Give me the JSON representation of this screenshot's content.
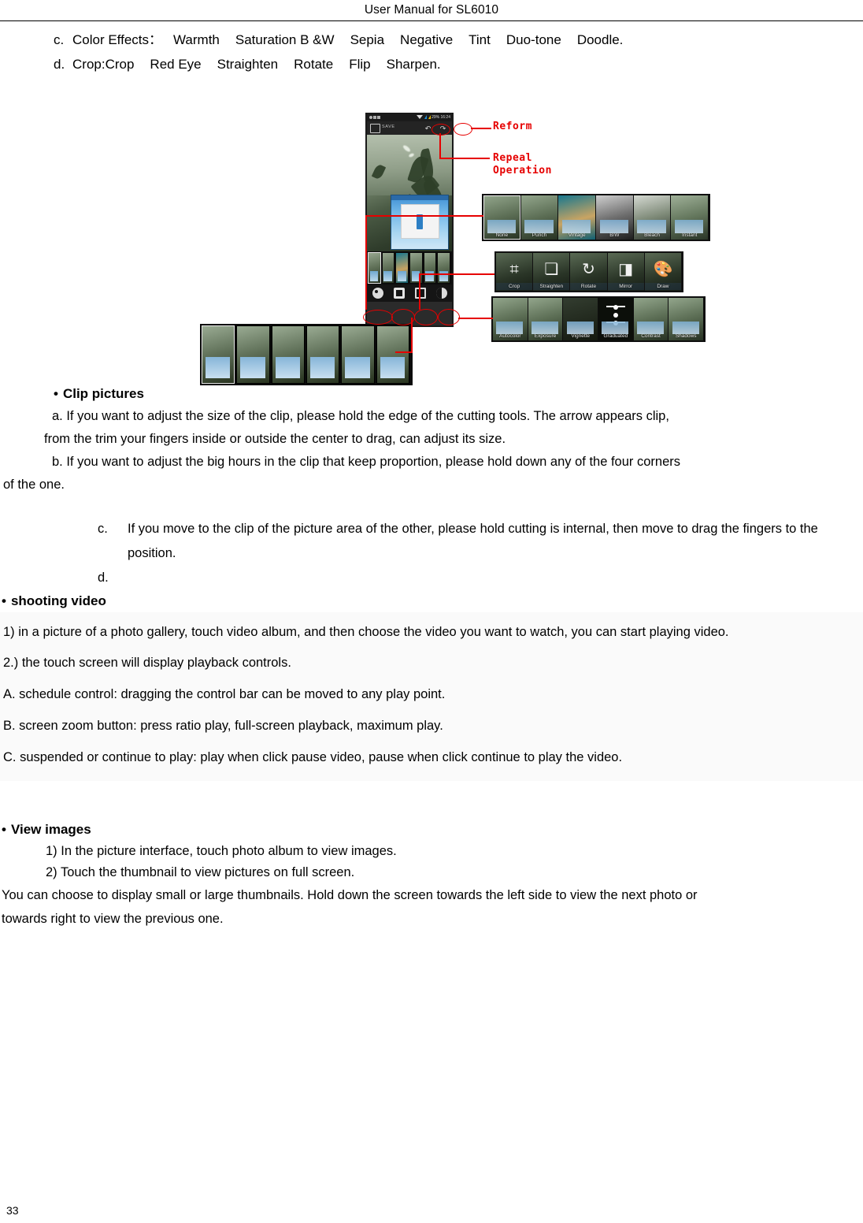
{
  "header": {
    "title": "User Manual for SL6010"
  },
  "top_list": {
    "c": {
      "label": "c.",
      "text": "Color Effects：",
      "items": [
        "Warmth",
        "Saturation B &W",
        "Sepia",
        "Negative",
        "Tint",
        "Duo-tone",
        "Doodle."
      ]
    },
    "d": {
      "label": "d.",
      "text": "Crop:Crop",
      "items": [
        "Red Eye",
        "Straighten",
        "Rotate",
        "Flip",
        "Sharpen."
      ]
    }
  },
  "figure": {
    "name": "photo-editor-screenshot",
    "annotations": [
      {
        "text": "Reform"
      },
      {
        "text": "Repeal\nOperation"
      }
    ],
    "phone": {
      "status_bar": {
        "battery": "29%",
        "time": "16:24"
      },
      "app_bar": {
        "save_label": "SAVE",
        "undo_icon": "undo-icon",
        "redo_icon": "redo-icon"
      },
      "toolbar_icons": [
        "filters-icon",
        "frames-icon",
        "crop-icon",
        "adjust-icon"
      ]
    },
    "filter_panel": {
      "labels": [
        "None",
        "Punch",
        "Vintage",
        "B/W",
        "Bleach",
        "Instant"
      ],
      "selected": "None"
    },
    "tools_panel": {
      "labels": [
        "Crop",
        "Straighten",
        "Rotate",
        "Mirror",
        "Draw"
      ],
      "glyphs": [
        "⌗",
        "❏",
        "↻",
        "◨",
        "🎨"
      ]
    },
    "adjust_panel": {
      "labels": [
        "Autocolor",
        "Exposure",
        "Vignette",
        "Graduated",
        "Contrast",
        "Shadows"
      ]
    }
  },
  "clip_section": {
    "heading": "Clip pictures",
    "bullet": "•",
    "a_line1": "a. If you want to adjust the size of the clip, please hold the edge of the cutting tools. The arrow appears clip,",
    "a_line2": "from the trim your fingers inside or outside the center to drag, can adjust its size.",
    "b_line1": "b. If you want to adjust the big hours in the clip that keep proportion, please hold down any of the four corners",
    "b_line2": "of the one.",
    "c_label": "c.",
    "c_text": "If you move to the clip of the picture area of the other, please hold cutting is internal, then move to drag the fingers to the position.",
    "d_label": "d.",
    "d_text": ""
  },
  "shooting_video": {
    "heading": "shooting video",
    "bullet": "•",
    "lines": [
      "1) in a picture of a photo gallery, touch video album, and then choose the video you want to watch, you can start playing video.",
      "2.) the touch screen will display playback controls.",
      "A. schedule control: dragging the control bar can be moved to any play point.",
      "B. screen zoom button: press ratio play, full-screen playback, maximum play.",
      "C. suspended or continue to play: play when click pause video, pause when click continue to play the video."
    ]
  },
  "view_images": {
    "heading": "View images",
    "bullet": "•",
    "item1": "1) In the picture interface, touch photo album to view images.",
    "item2": "2) Touch the thumbnail to view pictures on full screen.",
    "para_line1": "You can choose to display small or large thumbnails. Hold down the screen towards the left side to view the next photo or",
    "para_line2": "towards right to view the previous one."
  },
  "footer": {
    "page_number": "33"
  },
  "colors": {
    "annotation_red": "#e60000",
    "highlight_bg": "#fafafa",
    "text": "#000000"
  }
}
